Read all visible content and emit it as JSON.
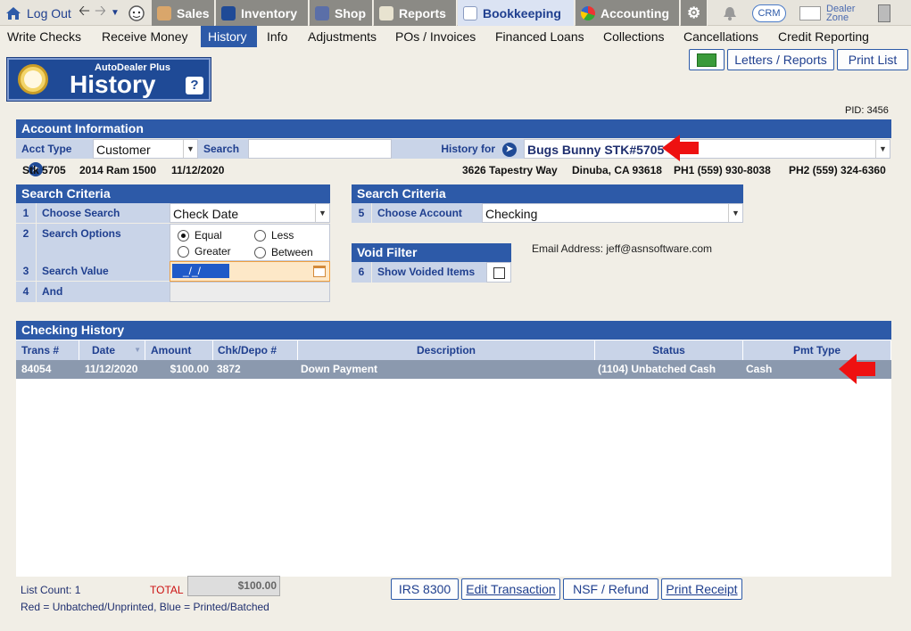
{
  "topbar": {
    "logout": "Log Out",
    "tabs": [
      "Sales",
      "Inventory",
      "Shop",
      "Reports",
      "Bookkeeping",
      "Accounting"
    ],
    "crm": "CRM",
    "dealer_zone_1": "Dealer",
    "dealer_zone_2": "Zone"
  },
  "submenu": [
    "Write Checks",
    "Receive Money",
    "History",
    "Info",
    "Adjustments",
    "POs / Invoices",
    "Financed Loans",
    "Collections",
    "Cancellations",
    "Credit Reporting"
  ],
  "title": {
    "small": "AutoDealer Plus",
    "big": "History",
    "help": "?"
  },
  "buttons": {
    "letters": "Letters / Reports",
    "print_list": "Print List"
  },
  "pid": "PID: 3456",
  "account": {
    "header": "Account Information",
    "acct_type_label": "Acct Type",
    "acct_type_value": "Customer",
    "search_label": "Search",
    "search_value": "",
    "history_for_label": "History for",
    "history_for_value": "Bugs Bunny  STK#5705",
    "stk": "Stk 5705",
    "vehicle": "2014 Ram 1500",
    "date": "11/12/2020",
    "address": "3626 Tapestry Way",
    "city": "Dinuba, CA 93618",
    "ph1": "PH1 (559) 930-8038",
    "ph2": "PH2 (559) 324-6360"
  },
  "criteria_left": {
    "header": "Search Criteria",
    "rows": [
      {
        "num": "1",
        "label": "Choose Search",
        "value": "Check Date"
      },
      {
        "num": "2",
        "label": "Search Options"
      },
      {
        "num": "3",
        "label": "Search Value",
        "value": "_/_/"
      },
      {
        "num": "4",
        "label": "And"
      }
    ],
    "options": [
      "Equal",
      "Less",
      "Greater",
      "Between"
    ]
  },
  "criteria_right": {
    "header": "Search Criteria",
    "num": "5",
    "label": "Choose Account",
    "value": "Checking"
  },
  "void_filter": {
    "header": "Void Filter",
    "num": "6",
    "label": "Show Voided Items"
  },
  "email": "Email Address: jeff@asnsoftware.com",
  "history": {
    "header": "Checking History",
    "columns": [
      "Trans #",
      "Date",
      "Amount",
      "Chk/Depo #",
      "Description",
      "Status",
      "Pmt Type"
    ],
    "rows": [
      {
        "trans": "84054",
        "date": "11/12/2020",
        "amount": "$100.00",
        "chk": "3872",
        "desc": "Down Payment",
        "status": "(1104) Unbatched Cash",
        "pmt": "Cash"
      }
    ]
  },
  "footer": {
    "list_count": "List Count: 1",
    "total_label": "TOTAL",
    "total_value": "$100.00",
    "legend": "Red = Unbatched/Unprinted, Blue = Printed/Batched",
    "buttons": [
      "IRS 8300",
      "Edit Transaction",
      "NSF / Refund",
      "Print Receipt"
    ]
  }
}
